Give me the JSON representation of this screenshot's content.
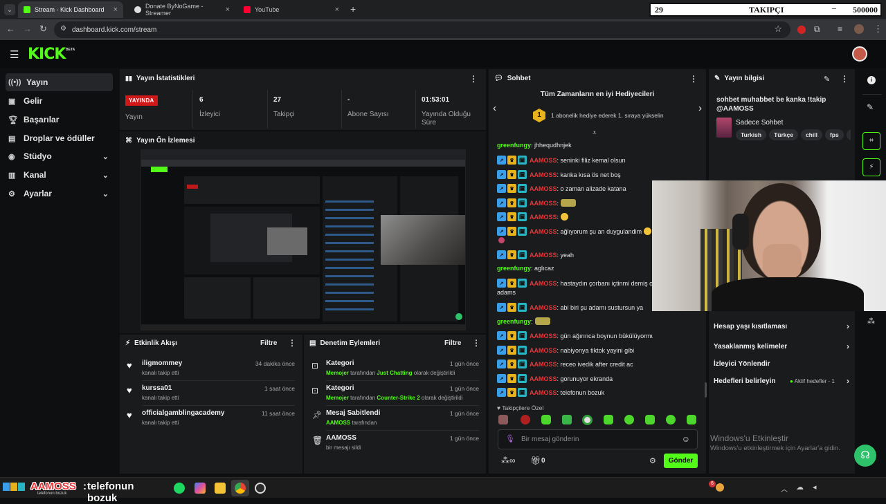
{
  "browser": {
    "tabs": [
      {
        "title": "Stream - Kick Dashboard",
        "active": true
      },
      {
        "title": "Donate ByNoGame - Streamer",
        "active": false
      },
      {
        "title": "YouTube",
        "active": false
      }
    ],
    "new_tab": "+",
    "url": "dashboard.kick.com/stream"
  },
  "overlay": {
    "left": "29",
    "center": "TAKIPÇI",
    "right": "500000"
  },
  "header": {
    "logo": "KICK",
    "beta": "BETA"
  },
  "sidebar": {
    "items": [
      {
        "label": "Yayın",
        "icon": "broadcast-icon",
        "active": true
      },
      {
        "label": "Gelir",
        "icon": "wallet-icon"
      },
      {
        "label": "Başarılar",
        "icon": "trophy-icon"
      },
      {
        "label": "Droplar ve ödüller",
        "icon": "gift-icon"
      },
      {
        "label": "Stüdyo",
        "icon": "camera-icon",
        "expandable": true
      },
      {
        "label": "Kanal",
        "icon": "channel-icon",
        "expandable": true
      },
      {
        "label": "Ayarlar",
        "icon": "gear-icon",
        "expandable": true
      }
    ]
  },
  "stats": {
    "title": "Yayın İstatistikleri",
    "live_badge": "YAYINDA",
    "live_label": "Yayın",
    "viewers_value": "6",
    "viewers_label": "İzleyici",
    "followers_value": "27",
    "followers_label": "Takipçi",
    "subs_value": "-",
    "subs_label": "Abone Sayısı",
    "duration_value": "01:53:01",
    "duration_label": "Yayında Olduğu Süre"
  },
  "preview": {
    "title": "Yayın Ön İzlemesi"
  },
  "activity": {
    "title": "Etkinlik Akışı",
    "filter": "Filtre",
    "items": [
      {
        "name": "iligmommey",
        "sub": "kanalı takip etti",
        "time": "34 dakika önce"
      },
      {
        "name": "kurssa01",
        "sub": "kanalı takip etti",
        "time": "1 saat önce"
      },
      {
        "name": "officialgamblingacademy",
        "sub": "kanalı takip etti",
        "time": "11 saat önce"
      }
    ]
  },
  "moderation": {
    "title": "Denetim Eylemleri",
    "filter": "Filtre",
    "items": [
      {
        "title": "Kategori",
        "user": "Memojer",
        "mid": "tarafından",
        "value": "Just Chatting",
        "tail": "olarak değiştirildi",
        "time": "1 gün önce"
      },
      {
        "title": "Kategori",
        "user": "Memojer",
        "mid": "tarafından",
        "value": "Counter-Strike 2",
        "tail": "olarak değiştirildi",
        "time": "1 gün önce"
      },
      {
        "title": "Mesaj Sabitlendi",
        "user": "AAMOSS",
        "mid": "tarafından",
        "value": "",
        "tail": "",
        "time": "1 gün önce"
      },
      {
        "title": "AAMOSS",
        "user": "",
        "mid": "bir mesajı sildi",
        "value": "",
        "tail": "",
        "time": "1 gün önce"
      }
    ]
  },
  "chat": {
    "title": "Sohbet",
    "gifters_title": "Tüm Zamanların en iyi Hediyecileri",
    "gifters_rank": "1",
    "gifters_text": "1 abonelik hediye ederek 1. sıraya yükselin",
    "messages": [
      {
        "user": "greenfungy",
        "text": "jhhequdhnjek",
        "type": "g"
      },
      {
        "user": "AAMOSS",
        "text": "seninki filiz kemal olsun",
        "type": "r"
      },
      {
        "user": "AAMOSS",
        "text": "kanka kısa ös net boş",
        "type": "r"
      },
      {
        "user": "AAMOSS",
        "text": "o zaman alizade katana",
        "type": "r"
      },
      {
        "user": "AAMOSS",
        "text": "",
        "type": "r",
        "emote": "t"
      },
      {
        "user": "AAMOSS",
        "text": "",
        "type": "r",
        "emote": "y"
      },
      {
        "user": "AAMOSS",
        "text": "ağlıyorum şu an duygulandim",
        "type": "r",
        "emote": "y"
      },
      {
        "user": "AAMOSS",
        "text": "yeah",
        "type": "r"
      },
      {
        "user": "greenfungy",
        "text": "aglıcaz",
        "type": "g"
      },
      {
        "user": "AAMOSS",
        "text": "hastaydın çorbanı içtinmi demiş o",
        "type": "r",
        "cont": "adams"
      },
      {
        "user": "AAMOSS",
        "text": "abi biri şu adamı sustursun ya",
        "type": "r"
      },
      {
        "user": "greenfungy",
        "text": "",
        "type": "g",
        "emote": "t"
      },
      {
        "user": "AAMOSS",
        "text": "gün ağırınca boynun bükülüyormu",
        "type": "r"
      },
      {
        "user": "AAMOSS",
        "text": "nabiyonya tiktok yayini gibi",
        "type": "r"
      },
      {
        "user": "AAMOSS",
        "text": "receo ivedik after credit ac",
        "type": "r"
      },
      {
        "user": "AAMOSS",
        "text": "gorunuyor ekranda",
        "type": "r"
      },
      {
        "user": "AAMOSS",
        "text": "telefonun bozuk",
        "type": "r"
      }
    ],
    "followers_only": "Takipçilere Özel",
    "input_placeholder": "Bir mesaj gönderin",
    "count": "0",
    "send": "Gönder"
  },
  "info": {
    "title": "Yayın bilgisi",
    "stream_title": "sohbet muhabbet be kanka !takip @AAMOSS",
    "category": "Sadece Sohbet",
    "tags": [
      "Turkish",
      "Türkçe",
      "chill",
      "fps",
      "fu"
    ],
    "menu": [
      {
        "label": "Hesap yaşı kısıtlaması",
        "extra": ""
      },
      {
        "label": "Yasaklanmış kelimeler",
        "extra": ""
      },
      {
        "label": "İzleyici Yönlendir",
        "extra": ""
      },
      {
        "label": "Hedefleri belirleyin",
        "extra": "Aktif hedefler - 1"
      }
    ]
  },
  "windows_watermark": {
    "line1": "Windows'u Etkinleştir",
    "line2": "Windows'u etkinleştirmek için Ayarlar'a gidin."
  },
  "ticker": {
    "user": "AAMOSS",
    "sep": ":",
    "text": "telefonun bozuk",
    "small": "telefonun bozuk"
  },
  "notification_count": "6",
  "colors": {
    "kick_green": "#53fc18",
    "live_red": "#d01818",
    "panel": "#191b1d",
    "bg": "#0e0f10"
  }
}
